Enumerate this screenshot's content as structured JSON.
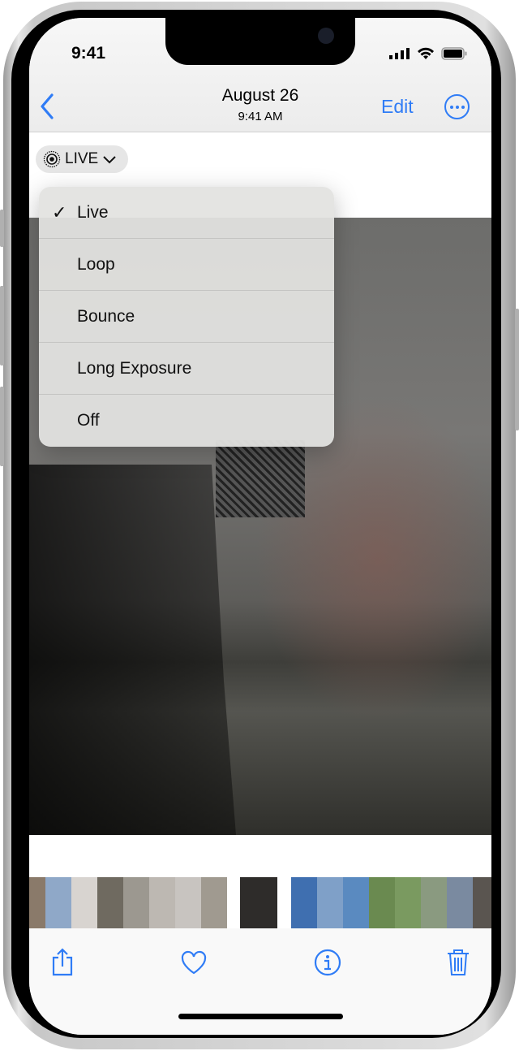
{
  "status_bar": {
    "time": "9:41"
  },
  "nav": {
    "title": "August 26",
    "subtitle": "9:41 AM",
    "edit_label": "Edit"
  },
  "live_button": {
    "label": "LIVE"
  },
  "menu": {
    "items": [
      {
        "label": "Live",
        "checked": true
      },
      {
        "label": "Loop",
        "checked": false
      },
      {
        "label": "Bounce",
        "checked": false
      },
      {
        "label": "Long Exposure",
        "checked": false
      },
      {
        "label": "Off",
        "checked": false
      }
    ],
    "check_glyph": "✓"
  },
  "thumbnails": {
    "colors": [
      "#8a7a6a",
      "#8fa8c8",
      "#d8d4d0",
      "#6f6a60",
      "#9c9890",
      "#bdb8b2",
      "#c8c4c0",
      "#a09a90",
      "#ffffff",
      "#2e2c2a",
      "#ffffff",
      "#3f6fb0",
      "#7fa0c8",
      "#5a8ac0",
      "#6a8a50",
      "#7a9a60",
      "#8a9a80",
      "#7a8aa0",
      "#5a5550"
    ]
  },
  "accent": "#2f7cf6"
}
